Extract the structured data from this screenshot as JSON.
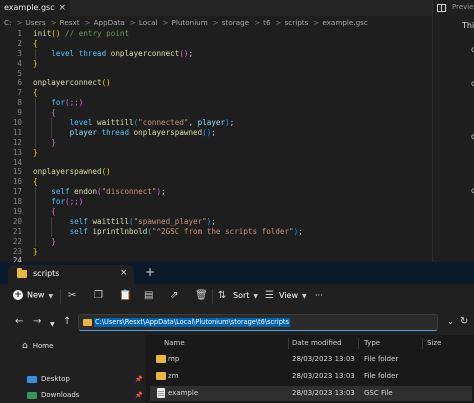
{
  "editor": {
    "tab": {
      "title": "example.gsc",
      "close": "×"
    },
    "breadcrumbs": [
      "C:",
      "Users",
      "Resxt",
      "AppData",
      "Local",
      "Plutonium",
      "storage",
      "t6",
      "scripts",
      "example.gsc"
    ],
    "breadcrumb_sep": ">",
    "line_numbers": [
      "1",
      "2",
      "3",
      "4",
      "5",
      "6",
      "7",
      "8",
      "9",
      "10",
      "11",
      "12",
      "13",
      "14",
      "15",
      "16",
      "17",
      "18",
      "19",
      "20",
      "21",
      "22",
      "23",
      "24"
    ],
    "lines": [
      {
        "tokens": [
          [
            "fn",
            "init"
          ],
          [
            "br1",
            "()"
          ],
          [
            "plain",
            " "
          ],
          [
            "cm",
            "// entry point"
          ]
        ]
      },
      {
        "tokens": [
          [
            "br1",
            "{"
          ]
        ]
      },
      {
        "tokens": [
          [
            "plain",
            "    "
          ],
          [
            "kw",
            "level"
          ],
          [
            "plain",
            " "
          ],
          [
            "kw",
            "thread"
          ],
          [
            "plain",
            " "
          ],
          [
            "fn",
            "onplayerconnect"
          ],
          [
            "br2",
            "()"
          ],
          [
            "plain",
            ";"
          ]
        ]
      },
      {
        "tokens": [
          [
            "br1",
            "}"
          ]
        ]
      },
      {
        "tokens": []
      },
      {
        "tokens": [
          [
            "fn",
            "onplayerconnect"
          ],
          [
            "br1",
            "()"
          ]
        ]
      },
      {
        "tokens": [
          [
            "br1",
            "{"
          ]
        ]
      },
      {
        "tokens": [
          [
            "plain",
            "    "
          ],
          [
            "kw",
            "for"
          ],
          [
            "br2",
            "(;;)"
          ]
        ]
      },
      {
        "tokens": [
          [
            "plain",
            "    "
          ],
          [
            "br2",
            "{"
          ]
        ]
      },
      {
        "tokens": [
          [
            "plain",
            "        "
          ],
          [
            "kw",
            "level"
          ],
          [
            "plain",
            " "
          ],
          [
            "fn",
            "waittill"
          ],
          [
            "br3",
            "("
          ],
          [
            "str",
            "\"connected\""
          ],
          [
            "plain",
            ", "
          ],
          [
            "var",
            "player"
          ],
          [
            "br3",
            ")"
          ],
          [
            "plain",
            ";"
          ]
        ]
      },
      {
        "tokens": [
          [
            "plain",
            "        "
          ],
          [
            "var",
            "player"
          ],
          [
            "plain",
            " "
          ],
          [
            "kw",
            "thread"
          ],
          [
            "plain",
            " "
          ],
          [
            "fn",
            "onplayerspawned"
          ],
          [
            "br3",
            "()"
          ],
          [
            "plain",
            ";"
          ]
        ]
      },
      {
        "tokens": [
          [
            "plain",
            "    "
          ],
          [
            "br2",
            "}"
          ]
        ]
      },
      {
        "tokens": [
          [
            "br1",
            "}"
          ]
        ]
      },
      {
        "tokens": []
      },
      {
        "tokens": [
          [
            "fn",
            "onplayerspawned"
          ],
          [
            "br1",
            "()"
          ]
        ]
      },
      {
        "tokens": [
          [
            "br1",
            "{"
          ]
        ]
      },
      {
        "tokens": [
          [
            "plain",
            "    "
          ],
          [
            "kw",
            "self"
          ],
          [
            "plain",
            " "
          ],
          [
            "fn",
            "endon"
          ],
          [
            "br2",
            "("
          ],
          [
            "str",
            "\"disconnect\""
          ],
          [
            "br2",
            ")"
          ],
          [
            "plain",
            ";"
          ]
        ]
      },
      {
        "tokens": [
          [
            "plain",
            "    "
          ],
          [
            "kw",
            "for"
          ],
          [
            "br2",
            "(;;)"
          ]
        ]
      },
      {
        "tokens": [
          [
            "plain",
            "    "
          ],
          [
            "br2",
            "{"
          ]
        ]
      },
      {
        "tokens": [
          [
            "plain",
            "        "
          ],
          [
            "kw",
            "self"
          ],
          [
            "plain",
            " "
          ],
          [
            "fn",
            "waittill"
          ],
          [
            "br3",
            "("
          ],
          [
            "str",
            "\"spawned_player\""
          ],
          [
            "br3",
            ")"
          ],
          [
            "plain",
            ";"
          ]
        ]
      },
      {
        "tokens": [
          [
            "plain",
            "        "
          ],
          [
            "kw",
            "self"
          ],
          [
            "plain",
            " "
          ],
          [
            "fn",
            "iprintlnbold"
          ],
          [
            "br3",
            "("
          ],
          [
            "str",
            "\"^2GSC from the scripts folder\""
          ],
          [
            "br3",
            ")"
          ],
          [
            "plain",
            ";"
          ]
        ]
      },
      {
        "tokens": [
          [
            "plain",
            "    "
          ],
          [
            "br2",
            "}"
          ]
        ]
      },
      {
        "tokens": [
          [
            "br1",
            "}"
          ]
        ]
      },
      {
        "tokens": []
      }
    ]
  },
  "sidepanel": {
    "preview_label": "Previe",
    "this_label": "This",
    "c_marks": [
      "c",
      "c",
      "c",
      "c"
    ]
  },
  "explorer": {
    "tab_title": "scripts",
    "tab_close": "×",
    "new_tab": "+",
    "toolbar": {
      "new_label": "New",
      "sort_label": "Sort",
      "view_label": "View",
      "more": "···"
    },
    "address": "C:\\Users\\Resxt\\AppData\\Local\\Plutonium\\storage\\t6\\scripts",
    "nav_pane": {
      "home": "Home",
      "desktop": "Desktop",
      "downloads": "Downloads"
    },
    "columns": [
      "Name",
      "Date modified",
      "Type",
      "Size"
    ],
    "files": [
      {
        "name": "mp",
        "date": "28/03/2023 13:03",
        "type": "File folder",
        "size": "",
        "kind": "folder"
      },
      {
        "name": "zm",
        "date": "28/03/2023 13:03",
        "type": "File folder",
        "size": "",
        "kind": "folder"
      },
      {
        "name": "example",
        "date": "28/03/2023 13:03",
        "type": "GSC File",
        "size": "",
        "kind": "file"
      }
    ]
  },
  "colors": {
    "accent": "#0063b1",
    "folder": "#e8b83e",
    "keyword": "#4fc1ff",
    "function": "#dcdcaa",
    "string": "#ce9178",
    "comment": "#6a9955"
  }
}
